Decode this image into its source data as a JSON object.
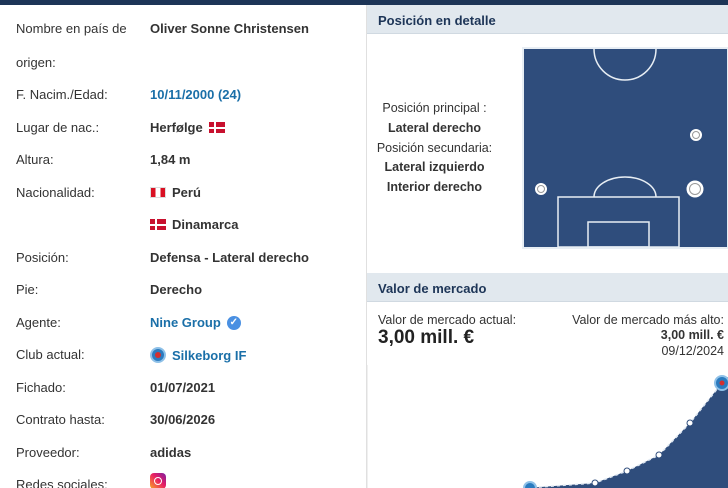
{
  "left_panel": {
    "rows": [
      {
        "label": "Nombre en país de",
        "label2": "origen:",
        "value": "Oliver Sonne Christensen"
      },
      {
        "label": "F. Nacim./Edad:",
        "value": "10/11/2000 (24)"
      },
      {
        "label": "Lugar de nac.:",
        "value": "Herfølge",
        "flag": "denmark-flag"
      },
      {
        "label": "Altura:",
        "value": "1,84 m"
      },
      {
        "label": "Nacionalidad:",
        "value": "Perú",
        "flag": "peru-flag",
        "value2": "Dinamarca",
        "flag2": "denmark-flag"
      },
      {
        "label": "Posición:",
        "value": "Defensa - Lateral derecho"
      },
      {
        "label": "Pie:",
        "value": "Derecho"
      },
      {
        "label": "Agente:",
        "value": "Nine Group",
        "icon": "verified-icon"
      },
      {
        "label": "Club actual:",
        "value": "Silkeborg IF",
        "icon": "club-crest-icon"
      },
      {
        "label": "Fichado:",
        "value": "01/07/2021"
      },
      {
        "label": "Contrato hasta:",
        "value": "30/06/2026"
      },
      {
        "label": "Proveedor:",
        "value": "adidas"
      },
      {
        "label": "Redes sociales:",
        "icon": "instagram-icon"
      }
    ]
  },
  "position_panel": {
    "title": "Posición en detalle",
    "main_label": "Posición principal :",
    "main_value": "Lateral derecho",
    "secondary_label": "Posición secundaria:",
    "secondary_values": [
      "Lateral izquierdo",
      "Interior derecho"
    ],
    "pitch_color": "#2f4d7c"
  },
  "market_panel": {
    "title": "Valor de mercado",
    "current_label": "Valor de mercado actual:",
    "current_value": "3,00 mill. €",
    "highest_label": "Valor de mercado más alto:",
    "highest_value": "3,00 mill. €",
    "highest_date": "09/12/2024",
    "accent": "#2f4d7c"
  }
}
